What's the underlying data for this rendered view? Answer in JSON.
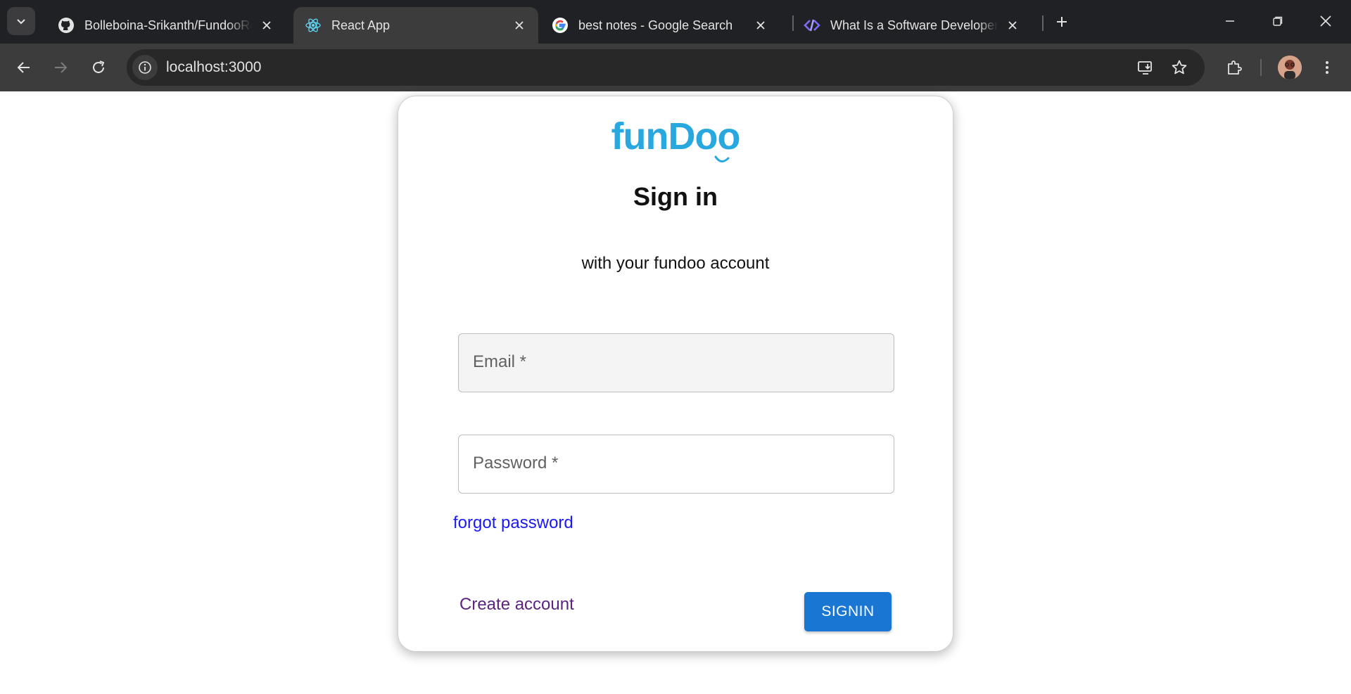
{
  "browser": {
    "tabs": [
      {
        "title": "Bolleboina-Srikanth/FundooReact",
        "favicon": "github-icon",
        "active": false
      },
      {
        "title": "React App",
        "favicon": "react-icon",
        "active": true
      },
      {
        "title": "best notes - Google Search",
        "favicon": "google-icon",
        "active": false
      },
      {
        "title": "What Is a Software Developer? | ",
        "favicon": "dev-site-icon",
        "active": false
      }
    ],
    "url": "localhost:3000"
  },
  "page": {
    "logo_text": "funDoo",
    "title": "Sign in",
    "subtitle": "with your fundoo account",
    "email_label": "Email *",
    "password_label": "Password *",
    "forgot_link": "forgot password",
    "create_account_link": "Create account",
    "signin_button": "SIGNIN"
  },
  "colors": {
    "chrome_bg": "#202124",
    "toolbar_bg": "#3c3c3c",
    "logo": "#29a8e0",
    "primary_button": "#1976d2",
    "link": "#1a1aee",
    "visited_link": "#5a2480"
  }
}
